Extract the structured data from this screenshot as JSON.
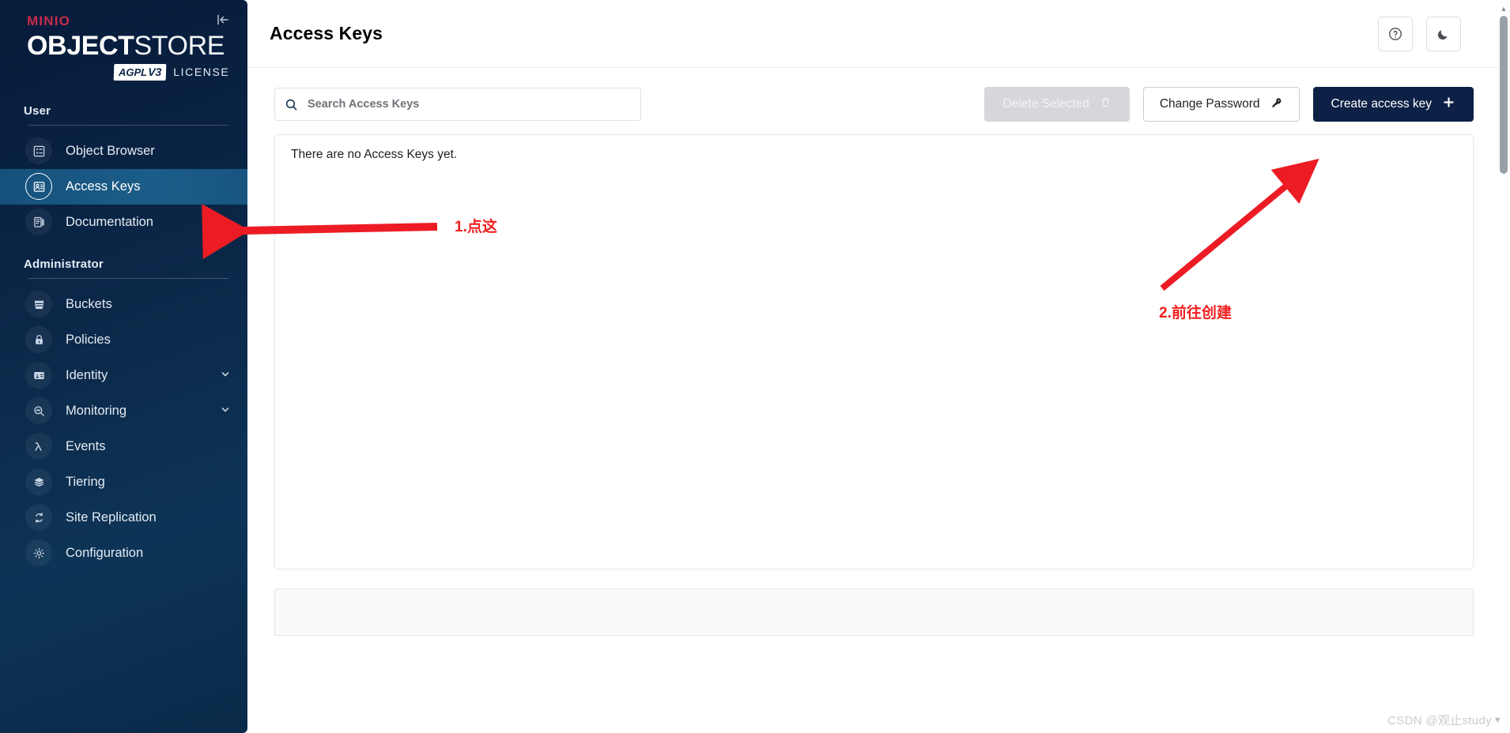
{
  "sidebar": {
    "logo": {
      "brand": "MINIO",
      "product_bold": "OBJECT",
      "product_thin": "STORE",
      "badge": "AGPL",
      "badge_version": "V3",
      "license_label": "LICENSE"
    },
    "collapse_icon": "collapse-left-icon",
    "sections": [
      {
        "title": "User",
        "items": [
          {
            "label": "Object Browser",
            "icon": "object-browser-icon",
            "active": false,
            "expandable": false
          },
          {
            "label": "Access Keys",
            "icon": "access-keys-icon",
            "active": true,
            "expandable": false
          },
          {
            "label": "Documentation",
            "icon": "documentation-icon",
            "active": false,
            "expandable": false
          }
        ]
      },
      {
        "title": "Administrator",
        "items": [
          {
            "label": "Buckets",
            "icon": "bucket-icon",
            "active": false,
            "expandable": false
          },
          {
            "label": "Policies",
            "icon": "lock-icon",
            "active": false,
            "expandable": false
          },
          {
            "label": "Identity",
            "icon": "identity-card-icon",
            "active": false,
            "expandable": true
          },
          {
            "label": "Monitoring",
            "icon": "monitoring-icon",
            "active": false,
            "expandable": true
          },
          {
            "label": "Events",
            "icon": "lambda-icon",
            "active": false,
            "expandable": false
          },
          {
            "label": "Tiering",
            "icon": "layers-icon",
            "active": false,
            "expandable": false
          },
          {
            "label": "Site Replication",
            "icon": "replication-icon",
            "active": false,
            "expandable": false
          },
          {
            "label": "Configuration",
            "icon": "gear-icon",
            "active": false,
            "expandable": false
          }
        ]
      }
    ]
  },
  "header": {
    "title": "Access Keys",
    "help_icon": "help-circle-icon",
    "theme_icon": "moon-icon"
  },
  "toolbar": {
    "search_placeholder": "Search Access Keys",
    "search_value": "",
    "search_icon": "search-icon",
    "delete_selected_label": "Delete Selected",
    "delete_icon": "trash-icon",
    "change_password_label": "Change Password",
    "change_password_icon": "key-icon",
    "create_access_key_label": "Create access key",
    "create_icon": "plus-icon"
  },
  "content": {
    "empty_message": "There are no Access Keys yet."
  },
  "annotations": [
    {
      "text": "1.点这",
      "color": "#f21f1f"
    },
    {
      "text": "2.前往创建",
      "color": "#f21f1f"
    }
  ],
  "watermark": {
    "text": "CSDN @观止study"
  }
}
